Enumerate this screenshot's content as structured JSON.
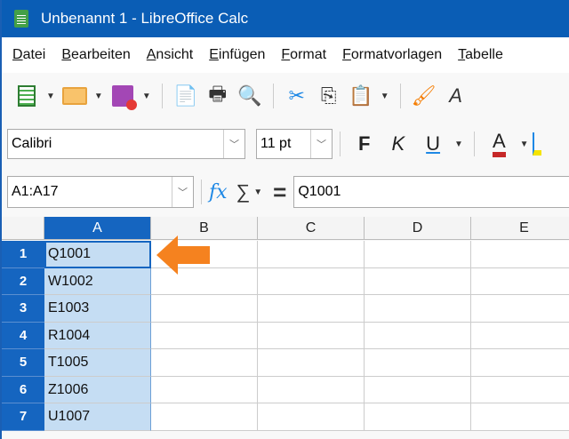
{
  "window": {
    "title": "Unbenannt 1 - LibreOffice Calc"
  },
  "menu": [
    "Datei",
    "Bearbeiten",
    "Ansicht",
    "Einfügen",
    "Format",
    "Formatvorlagen",
    "Tabelle"
  ],
  "toolbar": {
    "icons": [
      "new-spreadsheet-icon",
      "open-folder-icon",
      "save-icon",
      "export-pdf-icon",
      "print-icon",
      "print-preview-icon",
      "cut-icon",
      "copy-icon",
      "paste-icon",
      "clone-formatting-icon",
      "clear-formatting-icon"
    ]
  },
  "format": {
    "font": "Calibri",
    "size": "11 pt",
    "bold": "F",
    "italic": "K",
    "underline": "U",
    "font_color_letter": "A",
    "font_color": "#c62828"
  },
  "formula_bar": {
    "name_box": "A1:A17",
    "fx": "fx",
    "sum": "∑",
    "equals": "=",
    "content": "Q1001"
  },
  "sheet": {
    "columns": [
      "A",
      "B",
      "C",
      "D",
      "E"
    ],
    "selected_column": "A",
    "rows": [
      {
        "num": "1",
        "A": "Q1001"
      },
      {
        "num": "2",
        "A": "W1002"
      },
      {
        "num": "3",
        "A": "E1003"
      },
      {
        "num": "4",
        "A": "R1004"
      },
      {
        "num": "5",
        "A": "T1005"
      },
      {
        "num": "6",
        "A": "Z1006"
      },
      {
        "num": "7",
        "A": "U1007"
      }
    ]
  },
  "annotation": {
    "arrow_color": "#f5821f"
  }
}
